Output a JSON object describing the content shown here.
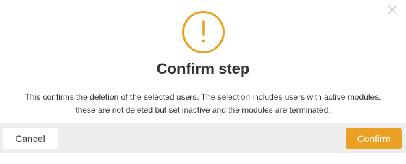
{
  "dialog": {
    "title": "Confirm step",
    "message_line1": "This confirms the deletion of the selected users. The selection includes users with active modules,",
    "message_line2": "these are not deleted but set inactive and the modules are terminated.",
    "icon": "warning-exclamation-icon",
    "close_icon": "close-icon",
    "accent_color": "#eaa123"
  },
  "footer": {
    "cancel_label": "Cancel",
    "confirm_label": "Confirm"
  }
}
